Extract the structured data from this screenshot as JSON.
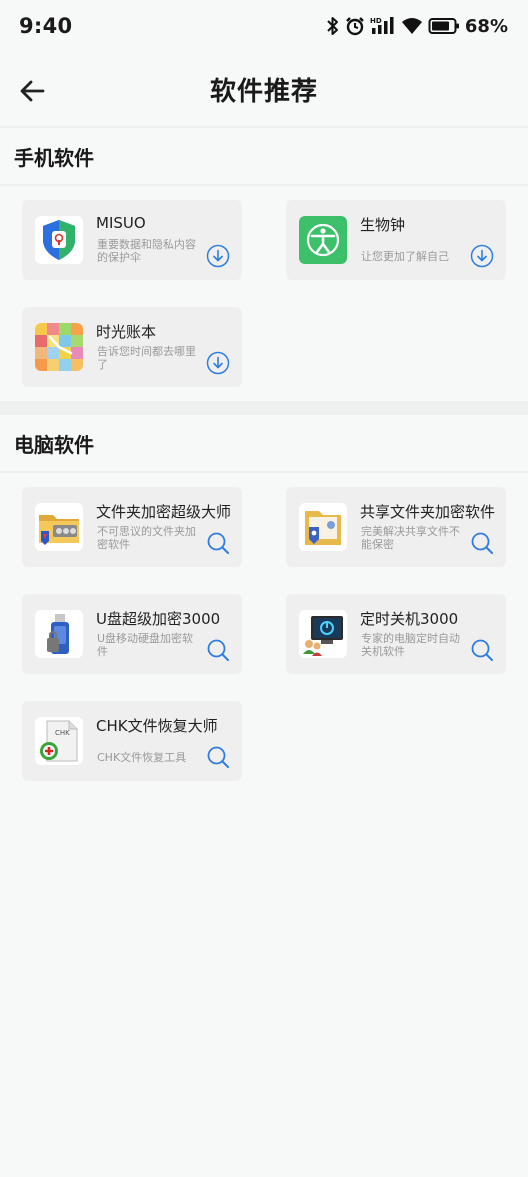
{
  "status_bar": {
    "time": "9:40",
    "battery_text": "68%",
    "icons": [
      "bluetooth-icon",
      "alarm-icon",
      "hd-signal-icon",
      "wifi-icon",
      "battery-icon"
    ]
  },
  "nav": {
    "title": "软件推荐",
    "back_icon": "arrow-left-icon"
  },
  "colors": {
    "accent": "#2f7de1",
    "card_bg": "#efefef",
    "page_bg": "#f7f8f8"
  },
  "sections": [
    {
      "title": "手机软件",
      "apps": [
        {
          "name": "MISUO",
          "desc": "重要数据和隐私内容的保护伞",
          "icon": "shield-icon",
          "action": "download-icon"
        },
        {
          "name": "生物钟",
          "desc": "让您更加了解自己",
          "icon": "person-circle-icon",
          "action": "download-icon"
        },
        {
          "name": "时光账本",
          "desc": "告诉您时间都去哪里了",
          "icon": "clock-mosaic-icon",
          "action": "download-icon"
        }
      ]
    },
    {
      "title": "电脑软件",
      "apps": [
        {
          "name": "文件夹加密超级大师",
          "desc": "不可思议的文件夹加密软件",
          "icon": "folder-lock-icon",
          "action": "search-icon"
        },
        {
          "name": "共享文件夹加密软件",
          "desc": "完美解决共享文件不能保密",
          "icon": "shared-folder-icon",
          "action": "search-icon"
        },
        {
          "name": "U盘超级加密3000",
          "desc": "U盘移动硬盘加密软件",
          "icon": "usb-drive-icon",
          "action": "search-icon"
        },
        {
          "name": "定时关机3000",
          "desc": "专家的电脑定时自动关机软件",
          "icon": "monitor-power-icon",
          "action": "search-icon"
        },
        {
          "name": "CHK文件恢复大师",
          "desc": "CHK文件恢复工具",
          "icon": "chk-file-icon",
          "action": "search-icon"
        }
      ]
    }
  ]
}
